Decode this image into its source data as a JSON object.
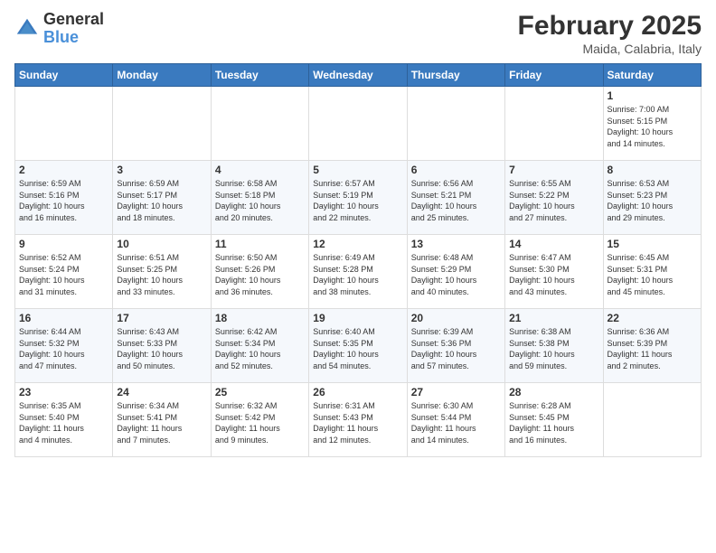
{
  "header": {
    "logo_general": "General",
    "logo_blue": "Blue",
    "month_title": "February 2025",
    "location": "Maida, Calabria, Italy"
  },
  "days_of_week": [
    "Sunday",
    "Monday",
    "Tuesday",
    "Wednesday",
    "Thursday",
    "Friday",
    "Saturday"
  ],
  "weeks": [
    [
      {
        "day": "",
        "info": ""
      },
      {
        "day": "",
        "info": ""
      },
      {
        "day": "",
        "info": ""
      },
      {
        "day": "",
        "info": ""
      },
      {
        "day": "",
        "info": ""
      },
      {
        "day": "",
        "info": ""
      },
      {
        "day": "1",
        "info": "Sunrise: 7:00 AM\nSunset: 5:15 PM\nDaylight: 10 hours\nand 14 minutes."
      }
    ],
    [
      {
        "day": "2",
        "info": "Sunrise: 6:59 AM\nSunset: 5:16 PM\nDaylight: 10 hours\nand 16 minutes."
      },
      {
        "day": "3",
        "info": "Sunrise: 6:59 AM\nSunset: 5:17 PM\nDaylight: 10 hours\nand 18 minutes."
      },
      {
        "day": "4",
        "info": "Sunrise: 6:58 AM\nSunset: 5:18 PM\nDaylight: 10 hours\nand 20 minutes."
      },
      {
        "day": "5",
        "info": "Sunrise: 6:57 AM\nSunset: 5:19 PM\nDaylight: 10 hours\nand 22 minutes."
      },
      {
        "day": "6",
        "info": "Sunrise: 6:56 AM\nSunset: 5:21 PM\nDaylight: 10 hours\nand 25 minutes."
      },
      {
        "day": "7",
        "info": "Sunrise: 6:55 AM\nSunset: 5:22 PM\nDaylight: 10 hours\nand 27 minutes."
      },
      {
        "day": "8",
        "info": "Sunrise: 6:53 AM\nSunset: 5:23 PM\nDaylight: 10 hours\nand 29 minutes."
      }
    ],
    [
      {
        "day": "9",
        "info": "Sunrise: 6:52 AM\nSunset: 5:24 PM\nDaylight: 10 hours\nand 31 minutes."
      },
      {
        "day": "10",
        "info": "Sunrise: 6:51 AM\nSunset: 5:25 PM\nDaylight: 10 hours\nand 33 minutes."
      },
      {
        "day": "11",
        "info": "Sunrise: 6:50 AM\nSunset: 5:26 PM\nDaylight: 10 hours\nand 36 minutes."
      },
      {
        "day": "12",
        "info": "Sunrise: 6:49 AM\nSunset: 5:28 PM\nDaylight: 10 hours\nand 38 minutes."
      },
      {
        "day": "13",
        "info": "Sunrise: 6:48 AM\nSunset: 5:29 PM\nDaylight: 10 hours\nand 40 minutes."
      },
      {
        "day": "14",
        "info": "Sunrise: 6:47 AM\nSunset: 5:30 PM\nDaylight: 10 hours\nand 43 minutes."
      },
      {
        "day": "15",
        "info": "Sunrise: 6:45 AM\nSunset: 5:31 PM\nDaylight: 10 hours\nand 45 minutes."
      }
    ],
    [
      {
        "day": "16",
        "info": "Sunrise: 6:44 AM\nSunset: 5:32 PM\nDaylight: 10 hours\nand 47 minutes."
      },
      {
        "day": "17",
        "info": "Sunrise: 6:43 AM\nSunset: 5:33 PM\nDaylight: 10 hours\nand 50 minutes."
      },
      {
        "day": "18",
        "info": "Sunrise: 6:42 AM\nSunset: 5:34 PM\nDaylight: 10 hours\nand 52 minutes."
      },
      {
        "day": "19",
        "info": "Sunrise: 6:40 AM\nSunset: 5:35 PM\nDaylight: 10 hours\nand 54 minutes."
      },
      {
        "day": "20",
        "info": "Sunrise: 6:39 AM\nSunset: 5:36 PM\nDaylight: 10 hours\nand 57 minutes."
      },
      {
        "day": "21",
        "info": "Sunrise: 6:38 AM\nSunset: 5:38 PM\nDaylight: 10 hours\nand 59 minutes."
      },
      {
        "day": "22",
        "info": "Sunrise: 6:36 AM\nSunset: 5:39 PM\nDaylight: 11 hours\nand 2 minutes."
      }
    ],
    [
      {
        "day": "23",
        "info": "Sunrise: 6:35 AM\nSunset: 5:40 PM\nDaylight: 11 hours\nand 4 minutes."
      },
      {
        "day": "24",
        "info": "Sunrise: 6:34 AM\nSunset: 5:41 PM\nDaylight: 11 hours\nand 7 minutes."
      },
      {
        "day": "25",
        "info": "Sunrise: 6:32 AM\nSunset: 5:42 PM\nDaylight: 11 hours\nand 9 minutes."
      },
      {
        "day": "26",
        "info": "Sunrise: 6:31 AM\nSunset: 5:43 PM\nDaylight: 11 hours\nand 12 minutes."
      },
      {
        "day": "27",
        "info": "Sunrise: 6:30 AM\nSunset: 5:44 PM\nDaylight: 11 hours\nand 14 minutes."
      },
      {
        "day": "28",
        "info": "Sunrise: 6:28 AM\nSunset: 5:45 PM\nDaylight: 11 hours\nand 16 minutes."
      },
      {
        "day": "",
        "info": ""
      }
    ]
  ]
}
